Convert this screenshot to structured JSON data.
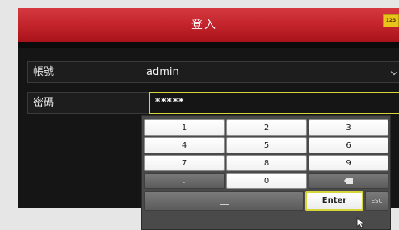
{
  "dialog": {
    "title": "登入",
    "accent_color": "#c12229"
  },
  "form": {
    "username": {
      "label": "帳號",
      "value": "admin"
    },
    "password": {
      "label": "密碼",
      "value": "*****"
    },
    "input_mode_button": "123"
  },
  "keypad": {
    "keys": [
      "1",
      "2",
      "3",
      "4",
      "5",
      "6",
      "7",
      "8",
      "9",
      ".",
      "0"
    ],
    "backspace_icon": "backspace-icon",
    "space_icon": "space-icon",
    "enter_label": "Enter",
    "esc_label": "ESC",
    "highlight_color": "#d6d63a"
  }
}
